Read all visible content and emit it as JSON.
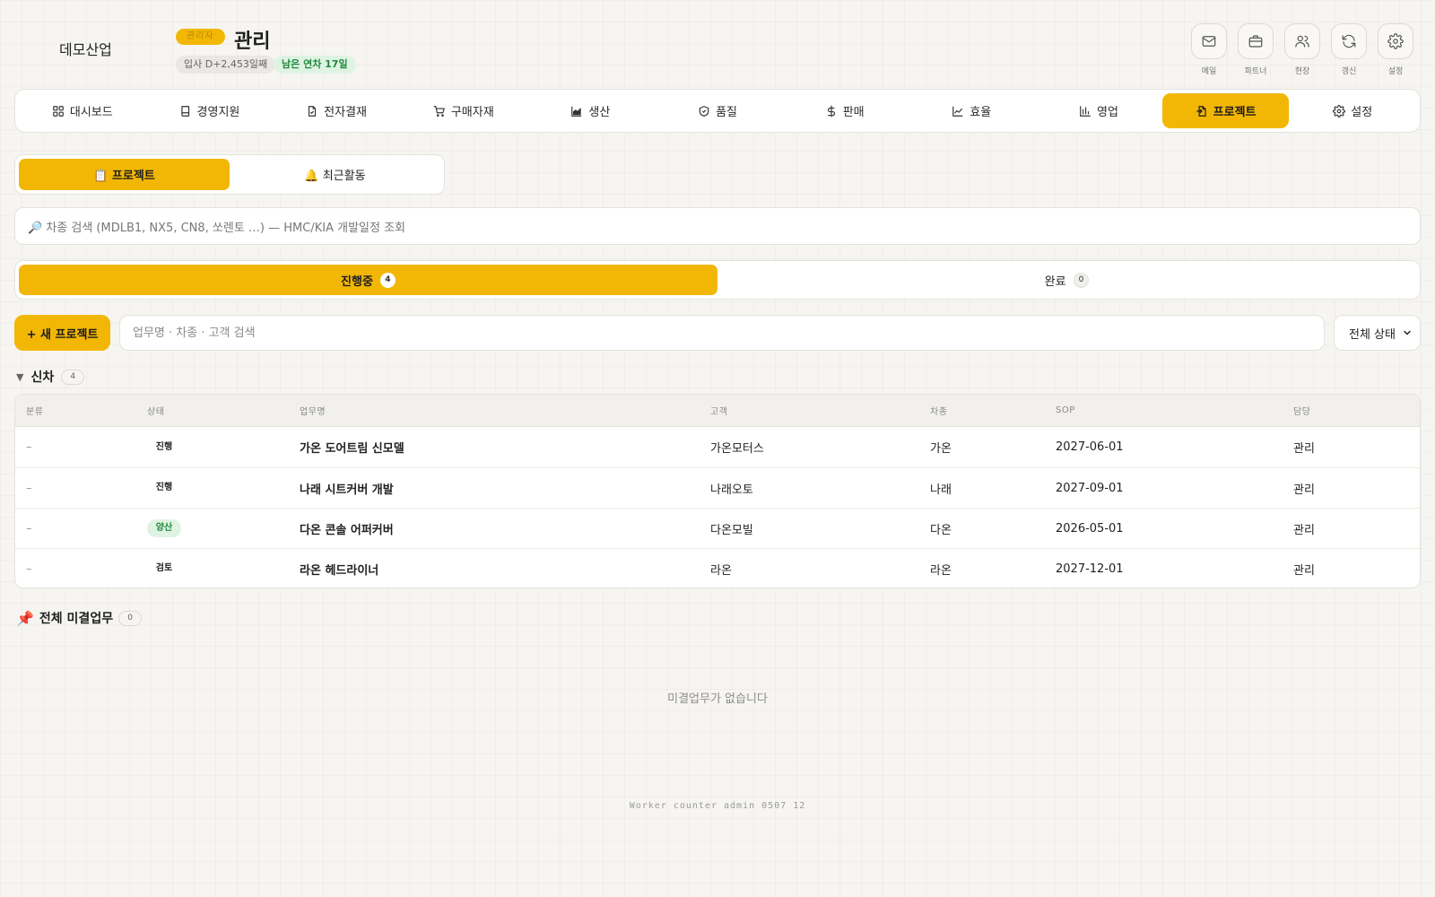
{
  "header": {
    "company": "데모산업",
    "role_badge": "관리자",
    "user_name": "관리",
    "hire_days": "입사 D+2,453일째",
    "annual_leave": "남은 연차 17일"
  },
  "quick_actions": [
    {
      "label": "메일",
      "icon": "mail-icon"
    },
    {
      "label": "파트너",
      "icon": "briefcase-icon"
    },
    {
      "label": "현장",
      "icon": "users-icon"
    },
    {
      "label": "갱신",
      "icon": "refresh-icon"
    },
    {
      "label": "설정",
      "icon": "gear-icon"
    }
  ],
  "nav": [
    {
      "label": "대시보드",
      "icon": "grid-icon"
    },
    {
      "label": "경영지원",
      "icon": "book-icon"
    },
    {
      "label": "전자결재",
      "icon": "document-check-icon"
    },
    {
      "label": "구매자재",
      "icon": "cart-icon"
    },
    {
      "label": "생산",
      "icon": "area-chart-icon"
    },
    {
      "label": "품질",
      "icon": "shield-check-icon"
    },
    {
      "label": "판매",
      "icon": "dollar-icon"
    },
    {
      "label": "효율",
      "icon": "line-chart-icon"
    },
    {
      "label": "영업",
      "icon": "bar-chart-icon"
    },
    {
      "label": "프로젝트",
      "icon": "project-icon",
      "active": true
    },
    {
      "label": "설정",
      "icon": "gear-icon"
    }
  ],
  "section_tabs": [
    {
      "label": "📋 프로젝트",
      "active": true
    },
    {
      "label": "🔔 최근활동",
      "active": false
    }
  ],
  "vehicle_search": {
    "placeholder": "🔎 차종 검색 (MDLB1, NX5, CN8, 쏘렌토 …) — HMC/KIA 개발일정 조회"
  },
  "status_tabs": [
    {
      "label": "진행중",
      "count": "4",
      "active": true
    },
    {
      "label": "완료",
      "count": "0",
      "active": false
    }
  ],
  "toolbar": {
    "new_button": "+ 새 프로젝트",
    "search_placeholder": "업무명 · 차종 · 고객 검색",
    "state_filter": "전체 상태"
  },
  "group": {
    "title": "신차",
    "count": "4"
  },
  "table": {
    "columns": [
      "분류",
      "상태",
      "업무명",
      "고객",
      "차종",
      "SOP",
      "담당"
    ],
    "rows": [
      {
        "category": "–",
        "status": "진행",
        "status_type": "normal",
        "name": "가온 도어트림 신모델",
        "customer": "가온모터스",
        "vehicle": "가온",
        "sop": "2027-06-01",
        "owner": "관리"
      },
      {
        "category": "–",
        "status": "진행",
        "status_type": "normal",
        "name": "나래 시트커버 개발",
        "customer": "나래오토",
        "vehicle": "나래",
        "sop": "2027-09-01",
        "owner": "관리"
      },
      {
        "category": "–",
        "status": "양산",
        "status_type": "prod",
        "name": "다온 콘솔 어퍼커버",
        "customer": "다온모빌",
        "vehicle": "다온",
        "sop": "2026-05-01",
        "owner": "관리"
      },
      {
        "category": "–",
        "status": "검토",
        "status_type": "normal",
        "name": "라온 헤드라이너",
        "customer": "라온",
        "vehicle": "라온",
        "sop": "2027-12-01",
        "owner": "관리"
      }
    ]
  },
  "pending": {
    "icon": "📌",
    "title": "전체 미결업무",
    "count": "0",
    "empty_message": "미결업무가 없습니다"
  },
  "footer_note": "Worker counter admin 0507 12",
  "colors": {
    "accent": "#f2b705",
    "success_text": "#1f8a3a",
    "success_bg": "#dff3e3",
    "background": "#f6f5f2"
  }
}
